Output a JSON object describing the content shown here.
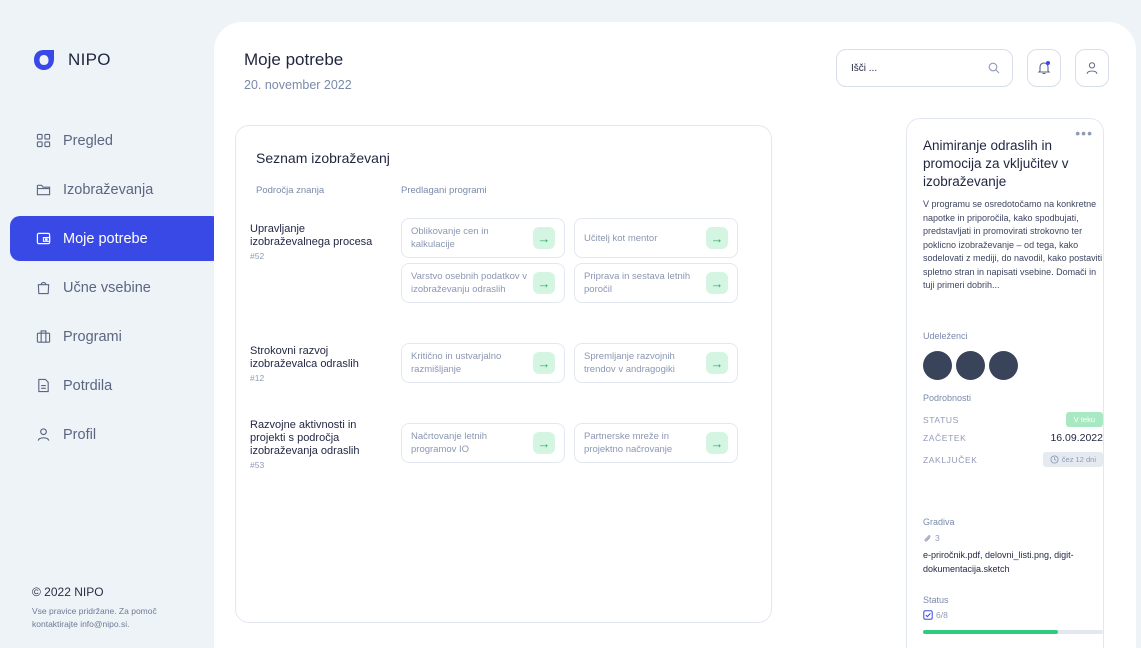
{
  "brand": {
    "name": "NIPO",
    "color": "#3949e6"
  },
  "nav": [
    {
      "label": "Pregled",
      "icon": "grid-icon"
    },
    {
      "label": "Izobraževanja",
      "icon": "folder-icon"
    },
    {
      "label": "Moje potrebe",
      "icon": "card-icon",
      "active": true
    },
    {
      "label": "Učne vsebine",
      "icon": "bag-icon"
    },
    {
      "label": "Programi",
      "icon": "briefcase-icon"
    },
    {
      "label": "Potrdila",
      "icon": "document-icon"
    },
    {
      "label": "Profil",
      "icon": "user-icon"
    }
  ],
  "footer": {
    "copyright": "© 2022 NIPO",
    "note": "Vse pravice pridržane. Za pomoč kontaktirajte info@nipo.si."
  },
  "header": {
    "title": "Moje potrebe",
    "date": "20. november 2022",
    "search_placeholder": "Išči ..."
  },
  "list": {
    "title": "Seznam izobraževanj",
    "col_areas": "Področja znanja",
    "col_programs": "Predlagani programi",
    "areas": [
      {
        "name": "Upravljanje izobraževalnega procesa",
        "code": "#52",
        "programs": [
          "Oblikovanje cen in kalkulacije",
          "Učitelj kot mentor",
          "Varstvo osebnih podatkov v izobraževanju odraslih",
          "Priprava in sestava letnih poročil"
        ]
      },
      {
        "name": "Strokovni razvoj izobraževalca odraslih",
        "code": "#12",
        "programs": [
          "Kritično in ustvarjalno razmišljanje",
          "Spremljanje razvojnih trendov v andragogiki"
        ]
      },
      {
        "name": "Razvojne aktivnosti in projekti s področja izobraževanja odraslih",
        "code": "#53",
        "programs": [
          "Načrtovanje letnih programov IO",
          "Partnerske mreže in projektno načrovanje"
        ]
      }
    ]
  },
  "detail": {
    "title": "Animiranje odraslih in promocija za vključitev v izobraževanje",
    "description": "V programu se osredotočamo na konkretne napotke in priporočila, kako spodbujati, predstavljati in promovirati strokovno ter poklicno izobraževanje – od tega, kako sodelovati z mediji, do navodil, kako postaviti spletno stran in napisati vsebine. Domači in tuji primeri dobrih...",
    "participants_label": "Udeleženci",
    "details_label": "Podrobnosti",
    "status_key": "STATUS",
    "status_value": "V teku",
    "start_key": "ZAČETEK",
    "start_value": "16.09.2022",
    "end_key": "ZAKLJUČEK",
    "end_value": "čez 12 dni",
    "materials_label": "Gradiva",
    "materials_count": "3",
    "materials_files": "e-priročnik.pdf, delovni_listi.png, digit-dokumentacija.sketch",
    "status_label": "Status",
    "status_count": "6/8",
    "progress": 0.75
  }
}
